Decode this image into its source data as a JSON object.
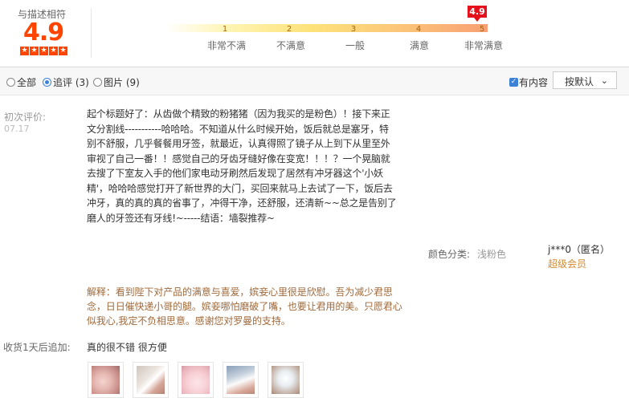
{
  "header": {
    "score_label": "与描述相符",
    "score": "4.9",
    "stars": 5,
    "marker": "4.9",
    "scale": [
      {
        "num": "1",
        "label": "非常不满"
      },
      {
        "num": "2",
        "label": "不满意"
      },
      {
        "num": "3",
        "label": "一般"
      },
      {
        "num": "4",
        "label": "满意"
      },
      {
        "num": "5",
        "label": "非常满意"
      }
    ]
  },
  "filters": {
    "all": "全部",
    "followup": "追评 (3)",
    "images": "图片 (9)",
    "selected": "追评 (3)",
    "has_content": "有内容",
    "sort": "按默认"
  },
  "review": {
    "first_label": "初次评价:",
    "first_date": "07.17",
    "text": "起个标题好了：从齿做个精致的粉猪猪（因为我买的是粉色）！接下来正文分割线-----------哈哈哈。不知道从什么时候开始，饭后就总是塞牙，特别不舒服，几乎餐餐用牙签，就最近，认真得照了镜子从上到下从里至外审视了自己一番！！感觉自己的牙齿牙缝好像在变宽！！！？一个晃脑就去搜了下室友入手的他们家电动牙刷然后发现了居然有冲牙器这个'小妖精'，哈哈哈感觉打开了新世界的大门，买回来就马上去试了一下，饭后去冲牙，真的真的真的省事了，冲得干净，还舒服，还清新~~总之是告别了磨人的牙签还有牙线!~-----结语：墙裂推荐~",
    "color_key": "颜色分类:",
    "color_value": "浅粉色",
    "user_name": "j***0（匿名）",
    "user_level": "超级会员",
    "reply": "解释：看到陛下对产品的满意与喜爱，嫔妾心里很是欣慰。吾为减少君思念，日日催快递小哥的腿。嫔妾哪怕磨破了嘴，也要让君用的美。只愿君心似我心,我定不负相思意。感谢您对罗曼的支持。",
    "followup_label": "收货1天后追加:",
    "followup_text": "真的很不错 很方便",
    "thumbnails": [
      "photo-1",
      "photo-2",
      "photo-3",
      "photo-4",
      "photo-5"
    ]
  },
  "colors": {
    "accent": "#ff4400",
    "marker": "#e4101b",
    "reply": "#a0693a",
    "member": "#d48a33",
    "checkbox": "#3b82d7"
  }
}
